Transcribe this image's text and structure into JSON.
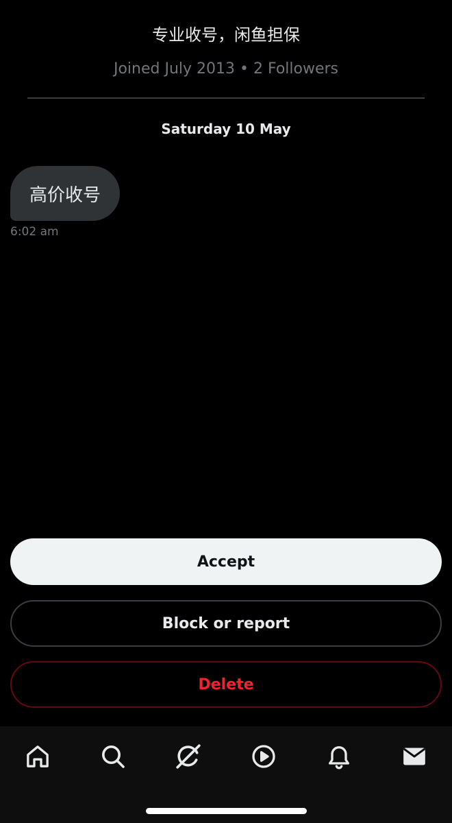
{
  "profile": {
    "bio": "专业收号，闲鱼担保",
    "joined_followers": "Joined July 2013 • 2 Followers"
  },
  "conversation": {
    "date_separator": "Saturday 10 May",
    "messages": [
      {
        "text": "高价收号",
        "time": "6:02 am"
      }
    ]
  },
  "request_actions": {
    "accept_label": "Accept",
    "block_label": "Block or report",
    "delete_label": "Delete"
  },
  "tab_bar": {
    "icons": [
      "home-icon",
      "search-icon",
      "grok-icon",
      "video-icon",
      "notifications-icon",
      "messages-icon"
    ],
    "active": "messages"
  },
  "colors": {
    "background": "#000000",
    "bubble": "#2f3336",
    "secondary_text": "#71767b",
    "accept_bg": "#eff3f4",
    "delete_red": "#f4212e"
  }
}
